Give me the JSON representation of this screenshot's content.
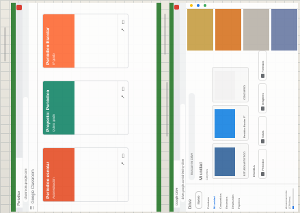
{
  "left_screenshot": {
    "tab_title": "Periodico",
    "url": "classroom.google.com",
    "brand": "Google Classroom",
    "cards": [
      {
        "title": "Periodico escolar",
        "subtitle": "Autoevaluación",
        "color": "#e8552e"
      },
      {
        "title": "Proyecto: Periódico",
        "subtitle": "Quinto grado",
        "color": "#1c8a6e"
      },
      {
        "title": "Periódico Escolar",
        "subtitle": "5º grado",
        "color": "#ff6f3c"
      }
    ]
  },
  "right_screenshot": {
    "tab_title": "Google Drive",
    "url": "drive.google.com/drive/my-drive",
    "app_name": "Drive",
    "new_button": "Nuevo",
    "nav": [
      "Prioritario",
      "Mi unidad",
      "Compartidos",
      "Recientes",
      "Destacados",
      "Papelera"
    ],
    "storage_text": "Almacenamiento (13% lleno)",
    "storage_fraction": 0.13,
    "search_placeholder": "Buscar en Drive",
    "heading": "Mi unidad",
    "subheading": "Carpetas",
    "files": [
      {
        "name": "ESTUDIO ARTISTICO",
        "color": "#3b6aa0"
      },
      {
        "name": "Periódico Escolar 5°",
        "color": "#1e88e5"
      },
      {
        "name": "CONCURSO",
        "color": "#f4f4f4"
      },
      {
        "name": "ESCUELA",
        "color": "#eeeeee"
      }
    ],
    "folders": [
      "Periódico",
      "Notas",
      "Imágenes",
      "Formatos"
    ],
    "photo_colors": [
      "#c9a24a",
      "#d97a2b",
      "#bcb6ad",
      "#6f7fa8"
    ],
    "rightbar_colors": [
      "#fbbc04",
      "#1a73e8",
      "#34a853"
    ]
  }
}
